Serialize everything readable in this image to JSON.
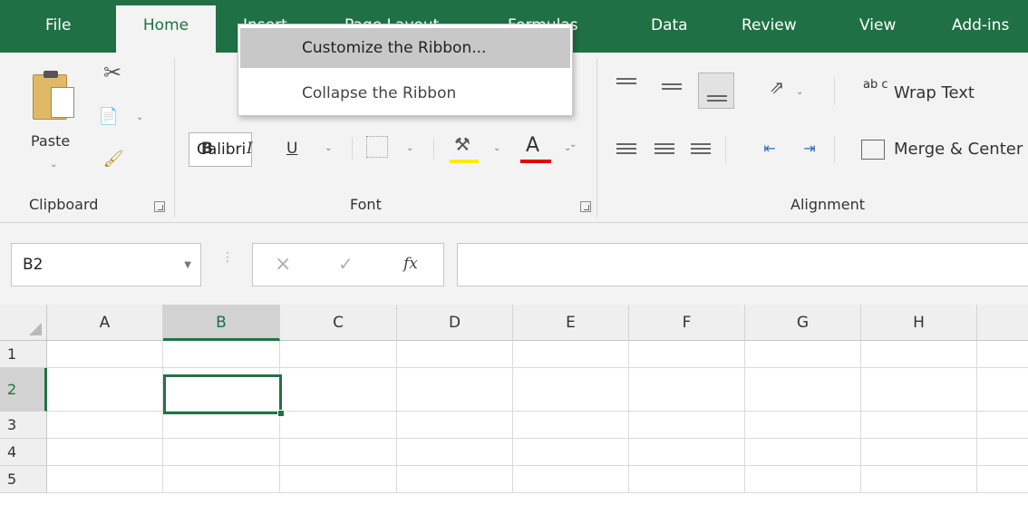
{
  "tabs": [
    {
      "label": "File",
      "active": false
    },
    {
      "label": "Home",
      "active": true
    },
    {
      "label": "Insert",
      "active": false
    },
    {
      "label": "Page Layout",
      "active": false
    },
    {
      "label": "Formulas",
      "active": false
    },
    {
      "label": "Data",
      "active": false
    },
    {
      "label": "Review",
      "active": false
    },
    {
      "label": "View",
      "active": false
    },
    {
      "label": "Add-ins",
      "active": false
    }
  ],
  "context_menu": {
    "items": [
      {
        "label": "Customize the Ribbon...",
        "highlighted": true
      },
      {
        "label": "Collapse the Ribbon",
        "highlighted": false
      }
    ]
  },
  "ribbon": {
    "clipboard": {
      "paste_label": "Paste",
      "group_label": "Clipboard"
    },
    "font": {
      "font_name": "Calibri",
      "bold": "B",
      "italic": "I",
      "underline": "U",
      "font_color_glyph": "A",
      "group_label": "Font"
    },
    "alignment": {
      "wrap_text_glyph": "ab c",
      "wrap_text_label": "Wrap Text",
      "merge_label": "Merge & Center",
      "group_label": "Alignment"
    }
  },
  "formula_bar": {
    "name_box": "B2",
    "cancel_glyph": "×",
    "enter_glyph": "✓",
    "fx_glyph": "fx",
    "formula": ""
  },
  "grid": {
    "columns": [
      "A",
      "B",
      "C",
      "D",
      "E",
      "F",
      "G",
      "H"
    ],
    "rows": [
      "1",
      "2",
      "3",
      "4",
      "5"
    ],
    "selected_column": "B",
    "selected_row": "2",
    "active_cell": "B2"
  },
  "colors": {
    "brand": "#1f7145",
    "selection": "#217346",
    "highlight_yellow": "#ffeb00",
    "font_red": "#e00000"
  }
}
